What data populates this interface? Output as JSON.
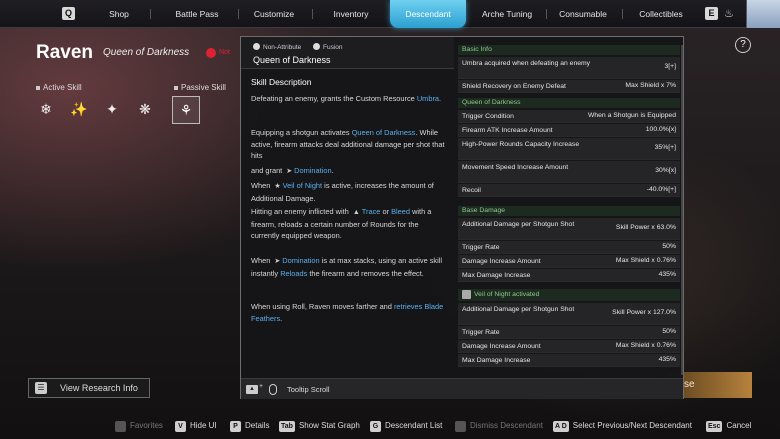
{
  "nav": {
    "left_key": "Q",
    "right_key": "E",
    "tabs": [
      {
        "label": "Shop"
      },
      {
        "label": "Battle Pass"
      },
      {
        "label": "Customize"
      },
      {
        "label": "Inventory"
      },
      {
        "label": "Descendant",
        "active": true
      },
      {
        "label": "Arche Tuning"
      },
      {
        "label": "Consumable"
      },
      {
        "label": "Collectibles"
      }
    ]
  },
  "character": {
    "name": "Raven",
    "subtitle": "Queen of Darkness",
    "warning": "Not"
  },
  "skills": {
    "active_label": "Active Skill",
    "passive_label": "Passive Skill"
  },
  "research_button": "View Research Info",
  "help_label": "?",
  "gold_button": "se",
  "tooltip": {
    "attribute": "Non-Attribute",
    "type": "Fusion",
    "skill_name": "Queen of Darkness",
    "desc_title": "Skill Description",
    "p1": {
      "pre": "Defeating an enemy, grants the Custom Resource",
      "hl": "Umbra",
      "post": "."
    },
    "p2": {
      "pre": "Equipping a shotgun activates",
      "hl": "Queen of Darkness",
      "post": ". While active, firearm attacks deal additional damage per shot that hits"
    },
    "p3": {
      "pre": "and grant",
      "hl": "Domination",
      "post": "."
    },
    "p4": {
      "pre": "When",
      "hl": "Veil of Night",
      "post": "is active, increases the amount of Additional Damage."
    },
    "p5": {
      "pre": "Hitting an enemy inflicted with",
      "hl1": "Trace",
      "mid": "or",
      "hl2": "Bleed",
      "post": "with a firearm, reloads a certain number of Rounds for the currently equipped weapon."
    },
    "p6": {
      "pre": "When",
      "hl": "Domination",
      "mid": "is at max stacks, using an active skill instantly",
      "hl2": "Reloads",
      "post": "the firearm and removes the effect."
    },
    "p7": {
      "pre": "When using Roll, Raven moves farther and",
      "hl": "retrieves Blade Feathers",
      "post": "."
    },
    "footer": "Tooltip Scroll",
    "footer_plus": "+"
  },
  "stats": {
    "basic": {
      "title": "Basic Info",
      "rows": [
        {
          "label": "Umbra acquired when defeating an enemy",
          "value": "3[+]"
        },
        {
          "label": "Shield Recovery on Enemy Defeat",
          "value": "Max Shield x 7%"
        }
      ]
    },
    "queen": {
      "title": "Queen of Darkness",
      "rows": [
        {
          "label": "Trigger Condition",
          "value": "When a Shotgun is Equipped"
        },
        {
          "label": "Firearm ATK Increase Amount",
          "value": "100.0%[x]"
        },
        {
          "label": "High-Power Rounds Capacity Increase",
          "value": "35%[+]"
        },
        {
          "label": "Movement Speed Increase Amount",
          "value": "30%[x]"
        },
        {
          "label": "Recoil",
          "value": "-40.0%[+]"
        }
      ]
    },
    "base": {
      "title": "Base Damage",
      "rows": [
        {
          "label": "Additional Damage per Shotgun Shot",
          "value": "Skill Power x 63.0%"
        },
        {
          "label": "Trigger Rate",
          "value": "50%"
        },
        {
          "label": "Damage Increase Amount",
          "value": "Max Shield x 0.76%"
        },
        {
          "label": "Max Damage Increase",
          "value": "435%"
        }
      ]
    },
    "veil": {
      "title": "Veil of Night activated",
      "rows": [
        {
          "label": "Additional Damage per Shotgun Shot",
          "value": "Skill Power x 127.0%"
        },
        {
          "label": "Trigger Rate",
          "value": "50%"
        },
        {
          "label": "Damage Increase Amount",
          "value": "Max Shield x 0.76%"
        },
        {
          "label": "Max Damage Increase",
          "value": "435%"
        }
      ]
    }
  },
  "bottom": [
    {
      "key": "",
      "label": "Favorites",
      "dim": true
    },
    {
      "key": "V",
      "label": "Hide UI"
    },
    {
      "key": "P",
      "label": "Details"
    },
    {
      "key": "Tab",
      "label": "Show Stat Graph"
    },
    {
      "key": "G",
      "label": "Descendant List"
    },
    {
      "key": "",
      "label": "Dismiss Descendant",
      "dim": true
    },
    {
      "key": "A D",
      "label": "Select Previous/Next Descendant"
    },
    {
      "key": "Esc",
      "label": "Cancel"
    }
  ]
}
